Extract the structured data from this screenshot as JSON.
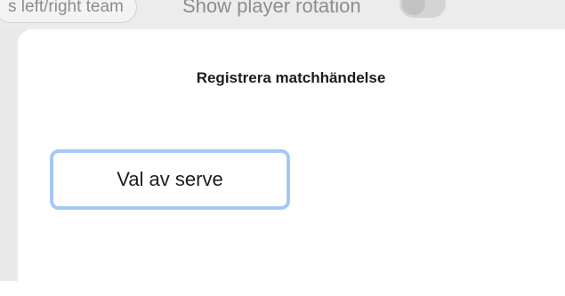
{
  "background": {
    "team_toggle_label": "s left/right team",
    "rotation_label": "Show player rotation"
  },
  "sheet": {
    "title": "Registrera matchhändelse",
    "event_button_label": "Val av serve"
  },
  "colors": {
    "button_border": "#a6c8f5",
    "title_text": "#1c1c1e",
    "backdrop": "#e9e9e9"
  }
}
